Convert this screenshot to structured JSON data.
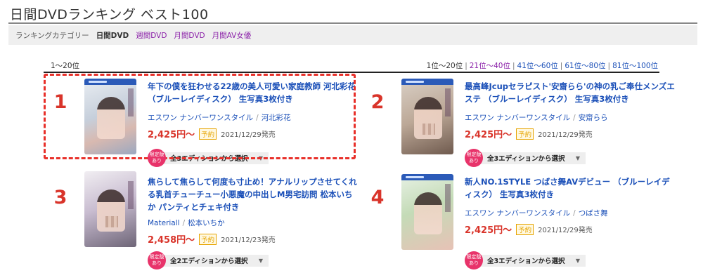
{
  "page": {
    "title": "日間DVDランキング ベスト100"
  },
  "category": {
    "label": "ランキングカテゴリー",
    "current": "日間DVD",
    "links": [
      "週間DVD",
      "月間DVD",
      "月間AV女優"
    ]
  },
  "range_label": "1〜20位",
  "pager": [
    "1位〜20位",
    "21位〜40位",
    "41位〜60位",
    "61位〜80位",
    "81位〜100位"
  ],
  "items": [
    {
      "rank": "1",
      "title": "年下の僕を狂わせる22歳の美人可愛い家庭教師 河北彩花 （ブルーレイディスク） 生写真3枚付き",
      "maker": "エスワン ナンバーワンスタイル",
      "actress": "河北彩花",
      "price": "2,425円〜",
      "yoyaku": "予約",
      "date": "2021/12/29発売",
      "badge_top": "限定版",
      "badge_bottom": "あり",
      "edition": "全3エディションから選択",
      "arrow": "▼"
    },
    {
      "rank": "2",
      "title": "最高峰Jcupセラピスト'安齋らら'の神の乳ご奉仕メンズエステ （ブルーレイディスク） 生写真3枚付き",
      "maker": "エスワン ナンバーワンスタイル",
      "actress": "安齋らら",
      "price": "2,425円〜",
      "yoyaku": "予約",
      "date": "2021/12/29発売",
      "badge_top": "限定版",
      "badge_bottom": "あり",
      "edition": "全3エディションから選択",
      "arrow": "▼"
    },
    {
      "rank": "3",
      "title": "焦らして焦らして何度も寸止め！アナルリップさせてくれる乳首チューチュー小悪魔の中出しM男宅訪問 松本いちか パンティとチェキ付き",
      "maker": "Materiall",
      "actress": "松本いちか",
      "price": "2,458円〜",
      "yoyaku": "予約",
      "date": "2021/12/23発売",
      "badge_top": "限定版",
      "badge_bottom": "あり",
      "edition": "全2エディションから選択",
      "arrow": "▼"
    },
    {
      "rank": "4",
      "title": "新人NO.1STYLE つばさ舞AVデビュー （ブルーレイディスク） 生写真3枚付き",
      "maker": "エスワン ナンバーワンスタイル",
      "actress": "つばさ舞",
      "price": "2,425円〜",
      "yoyaku": "予約",
      "date": "2021/12/29発売",
      "badge_top": "限定版",
      "badge_bottom": "あり",
      "edition": "全3エディションから選択",
      "arrow": "▼"
    }
  ],
  "colors": {
    "rank": "#d9342a",
    "link": "#1a4fb8",
    "category_link": "#8a1fa8",
    "highlight": "#e8302a"
  }
}
